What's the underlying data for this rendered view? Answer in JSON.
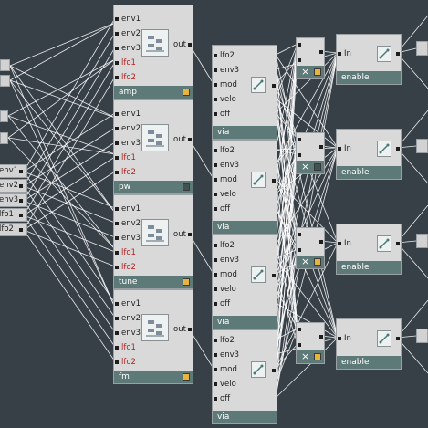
{
  "colors": {
    "background": "#373f47",
    "module": "#d9d9d9",
    "footer": "#5e7a78",
    "led_on": "#e8b53a",
    "led_off": "#3f5352",
    "wire": "#ffffff",
    "cv_label": "#b3201f"
  },
  "left_inputs": [
    {
      "label": "env1"
    },
    {
      "label": "env2"
    },
    {
      "label": "env3"
    },
    {
      "label": "lfo1"
    },
    {
      "label": "lfo2"
    }
  ],
  "mixers": [
    {
      "title": "amp",
      "inputs": [
        "env1",
        "env2",
        "env3",
        "lfo1",
        "lfo2"
      ],
      "output": "out",
      "led": "on"
    },
    {
      "title": "pw",
      "inputs": [
        "env1",
        "env2",
        "env3",
        "lfo1",
        "lfo2"
      ],
      "output": "out",
      "led": "off"
    },
    {
      "title": "tune",
      "inputs": [
        "env1",
        "env2",
        "env3",
        "lfo1",
        "lfo2"
      ],
      "output": "out",
      "led": "on"
    },
    {
      "title": "fm",
      "inputs": [
        "env1",
        "env2",
        "env3",
        "lfo1",
        "lfo2"
      ],
      "output": "out",
      "led": "on"
    }
  ],
  "vias": [
    {
      "title": "via",
      "inputs": [
        "lfo2",
        "env3",
        "mod",
        "velo",
        "off"
      ]
    },
    {
      "title": "via",
      "inputs": [
        "lfo2",
        "env3",
        "mod",
        "velo",
        "off"
      ]
    },
    {
      "title": "via",
      "inputs": [
        "lfo2",
        "env3",
        "mod",
        "velo",
        "off"
      ]
    },
    {
      "title": "via",
      "inputs": [
        "lfo2",
        "env3",
        "mod",
        "velo",
        "off"
      ]
    }
  ],
  "multipliers": [
    {
      "led": "on"
    },
    {
      "led": "off"
    },
    {
      "led": "on"
    },
    {
      "led": "on"
    }
  ],
  "enables": [
    {
      "title": "enable",
      "input": "In"
    },
    {
      "title": "enable",
      "input": "In"
    },
    {
      "title": "enable",
      "input": "In"
    },
    {
      "title": "enable",
      "input": "In"
    }
  ]
}
